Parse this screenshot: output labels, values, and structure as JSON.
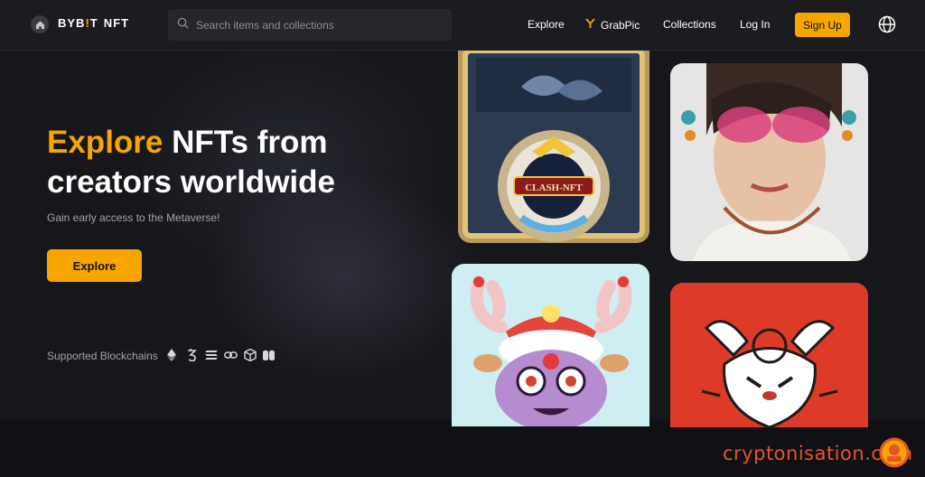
{
  "brand": {
    "name_a": "BYB",
    "name_slash": "!",
    "name_b": "T",
    "name_nft": "NFT"
  },
  "search": {
    "placeholder": "Search items and collections"
  },
  "nav": {
    "explore": "Explore",
    "grabpic": "GrabPic",
    "collections": "Collections",
    "login": "Log In",
    "signup": "Sign Up"
  },
  "hero": {
    "title_accent": "Explore",
    "title_rest_line1": " NFTs from",
    "title_line2": "creators worldwide",
    "subtitle": "Gain early access to the Metaverse!",
    "cta": "Explore"
  },
  "blockchains": {
    "label": "Supported Blockchains",
    "icons": [
      "ethereum-icon",
      "tezos-icon",
      "solana-icon",
      "chain-link-icon",
      "cube-icon",
      "polygon-icon"
    ]
  },
  "cards": {
    "card1_badge": "CLASH-NFT"
  },
  "watermark": {
    "text": "cryptonisation.com"
  },
  "colors": {
    "accent": "#f7a600",
    "background": "#17181c",
    "header": "#1b1c20",
    "watermark": "#e8542a"
  }
}
